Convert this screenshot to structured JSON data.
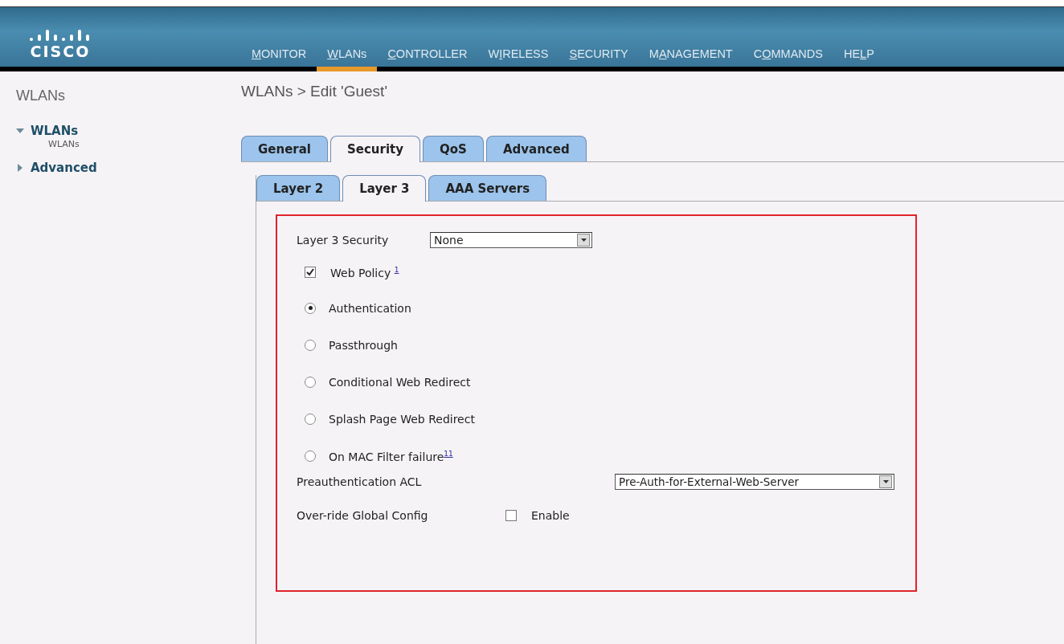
{
  "header": {
    "logo_text": "CISCO",
    "menu": [
      {
        "key": "M",
        "post": "ONITOR",
        "selected": false
      },
      {
        "key": "W",
        "post": "LANs",
        "selected": true
      },
      {
        "key": "C",
        "post": "ONTROLLER",
        "selected": false
      },
      {
        "pre": "W",
        "key": "I",
        "post": "RELESS",
        "selected": false
      },
      {
        "key": "S",
        "post": "ECURITY",
        "selected": false
      },
      {
        "pre": "M",
        "key": "A",
        "post": "NAGEMENT",
        "selected": false
      },
      {
        "pre": "C",
        "key": "O",
        "post": "MMANDS",
        "selected": false
      },
      {
        "pre": "HE",
        "key": "L",
        "post": "P",
        "selected": false
      }
    ]
  },
  "sidebar": {
    "title": "WLANs",
    "items": [
      {
        "label": "WLANs",
        "expanded": true,
        "children": [
          {
            "label": "WLANs"
          }
        ]
      },
      {
        "label": "Advanced",
        "expanded": false
      }
    ]
  },
  "page_title": "WLANs > Edit  'Guest'",
  "tabs": [
    {
      "label": "General",
      "selected": false
    },
    {
      "label": "Security",
      "selected": true
    },
    {
      "label": "QoS",
      "selected": false
    },
    {
      "label": "Advanced",
      "selected": false
    }
  ],
  "subtabs": [
    {
      "label": "Layer 2",
      "selected": false
    },
    {
      "label": "Layer 3",
      "selected": true
    },
    {
      "label": "AAA Servers",
      "selected": false
    }
  ],
  "form": {
    "layer3_security": {
      "label": "Layer 3 Security",
      "value": "None"
    },
    "web_policy": {
      "label": "Web Policy",
      "footnote": "1",
      "checked": true
    },
    "options": [
      {
        "label": "Authentication",
        "selected": true
      },
      {
        "label": "Passthrough",
        "selected": false
      },
      {
        "label": "Conditional Web Redirect",
        "selected": false
      },
      {
        "label": "Splash Page Web Redirect",
        "selected": false
      },
      {
        "label": "On MAC Filter failure",
        "footnote": "11",
        "selected": false
      }
    ],
    "preauth_acl": {
      "label": "Preauthentication ACL",
      "value": "Pre-Auth-for-External-Web-Server"
    },
    "override": {
      "label": "Over-ride Global Config",
      "option": "Enable",
      "checked": false
    }
  }
}
